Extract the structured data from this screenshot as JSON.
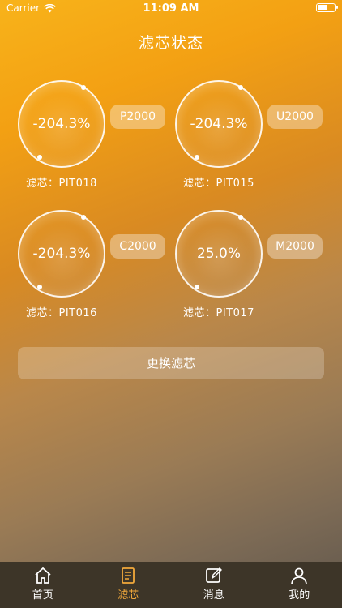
{
  "status_bar": {
    "carrier": "Carrier",
    "time": "11:09 AM"
  },
  "page_title": "滤芯状态",
  "filters": [
    {
      "percent": "-204.3%",
      "model": "P2000",
      "label": "滤芯：PIT018"
    },
    {
      "percent": "-204.3%",
      "model": "U2000",
      "label": "滤芯：PIT015"
    },
    {
      "percent": "-204.3%",
      "model": "C2000",
      "label": "滤芯：PIT016"
    },
    {
      "percent": "25.0%",
      "model": "M2000",
      "label": "滤芯：PIT017"
    }
  ],
  "replace_button": "更换滤芯",
  "tabs": [
    {
      "label": "首页",
      "icon": "home-icon"
    },
    {
      "label": "滤芯",
      "icon": "document-icon"
    },
    {
      "label": "消息",
      "icon": "edit-icon"
    },
    {
      "label": "我的",
      "icon": "user-icon"
    }
  ],
  "accent_color": "#f2a93b"
}
